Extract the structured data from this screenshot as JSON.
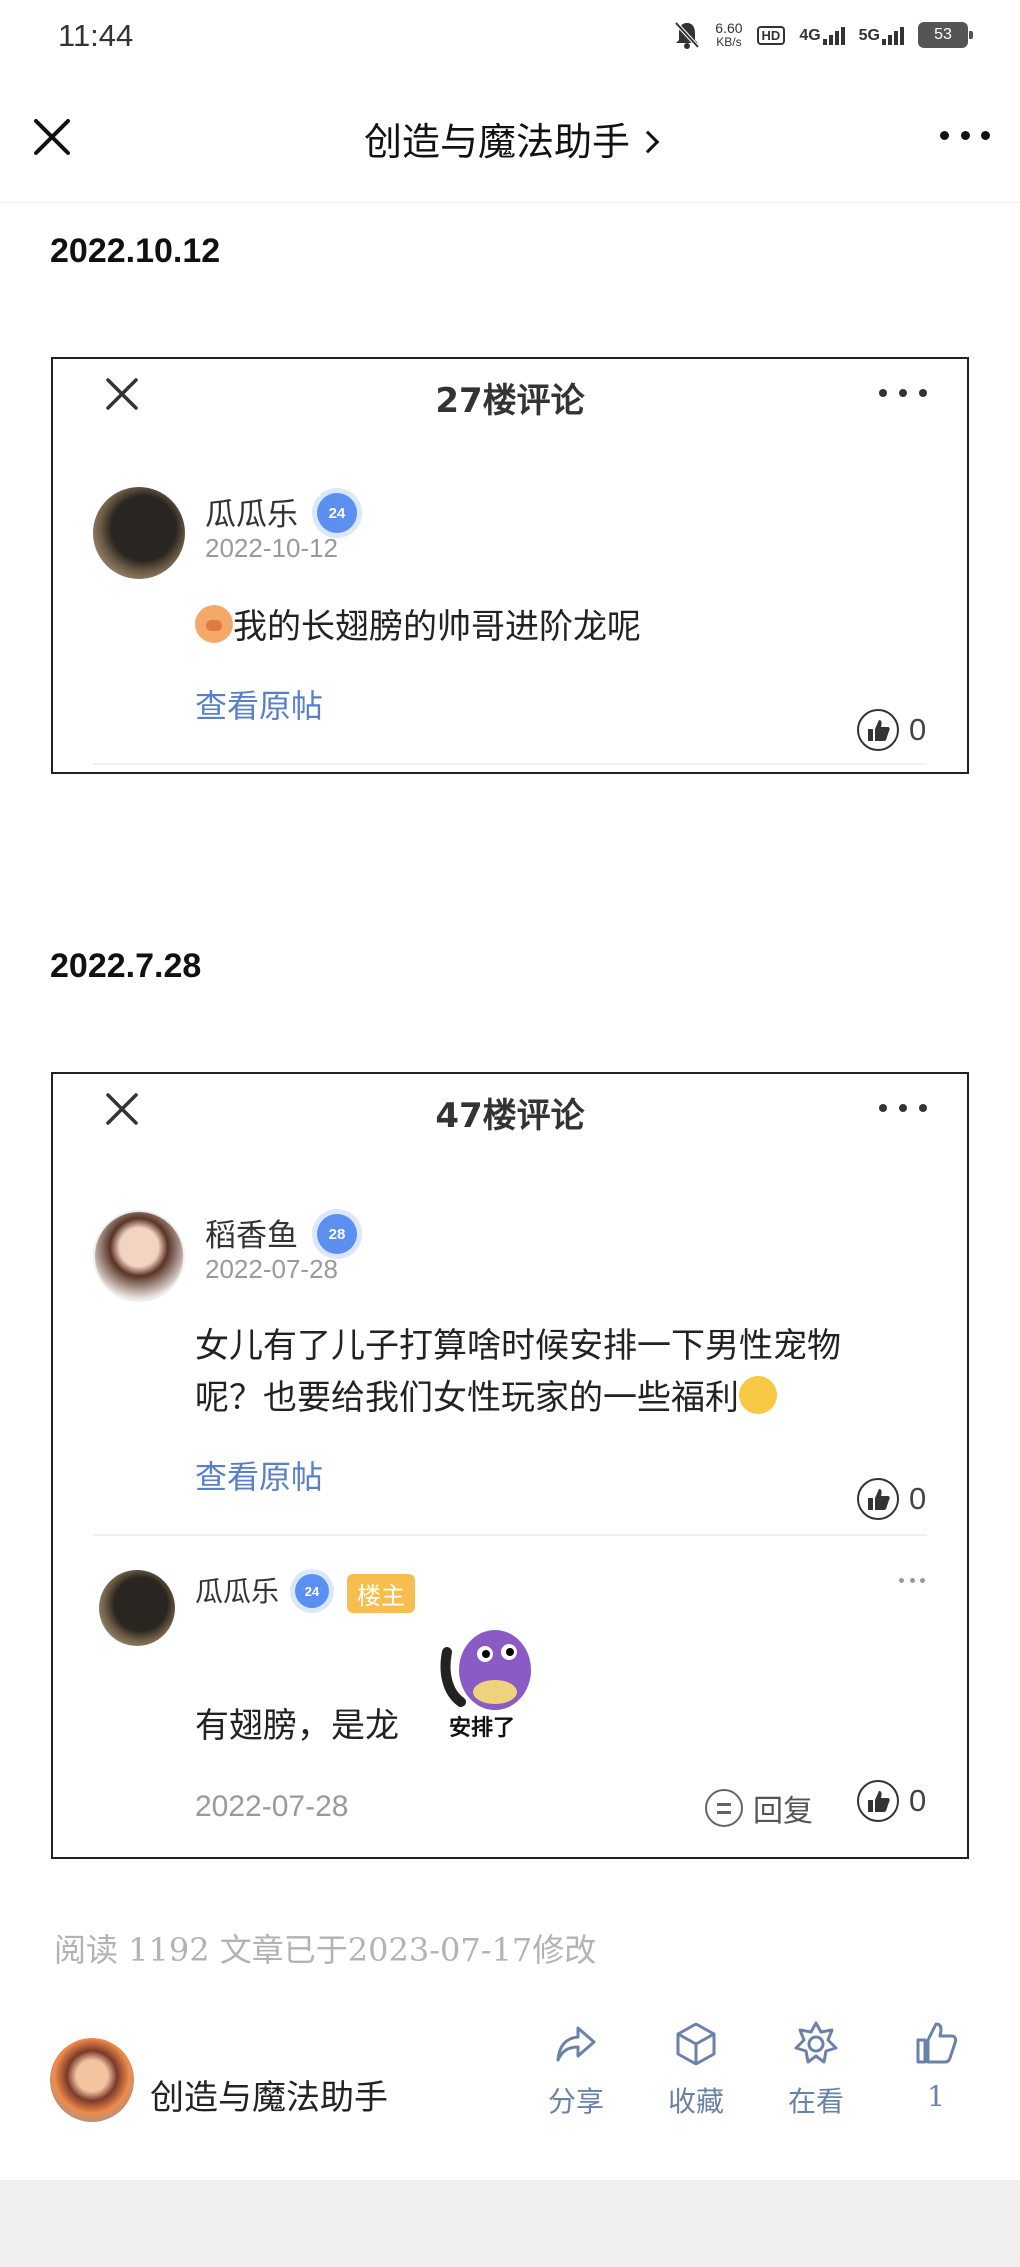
{
  "status_bar": {
    "time": "11:44",
    "net_speed_value": "6.60",
    "net_speed_unit": "KB/s",
    "hd_label": "HD",
    "sig1": "4G",
    "sig2": "5G",
    "battery": "53"
  },
  "nav": {
    "title": "创造与魔法助手",
    "close_icon": "close-icon",
    "more_icon": "more-icon"
  },
  "section1": {
    "date": "2022.10.12",
    "card": {
      "title": "27楼评论",
      "user": "瓜瓜乐",
      "level": "24",
      "date": "2022-10-12",
      "text": "我的长翅膀的帅哥进阶龙呢",
      "view_original": "查看原帖",
      "likes": "0"
    }
  },
  "section2": {
    "date": "2022.7.28",
    "card": {
      "title": "47楼评论",
      "user": "稻香鱼",
      "level": "28",
      "date": "2022-07-28",
      "text_line1": "女儿有了儿子打算啥时候安排一下男性宠物",
      "text_line2": "呢？也要给我们女性玩家的一些福利",
      "view_original": "查看原帖",
      "likes": "0",
      "reply": {
        "user": "瓜瓜乐",
        "level": "24",
        "badge": "楼主",
        "text": "有翅膀，是龙",
        "sticker_text": "安排了",
        "date": "2022-07-28",
        "reply_label": "回复",
        "likes": "0"
      }
    }
  },
  "footer": {
    "read_info": "阅读 1192   文章已于2023-07-17修改",
    "author": "创造与魔法助手",
    "actions": [
      {
        "label": "分享",
        "icon": "share-icon"
      },
      {
        "label": "收藏",
        "icon": "favorite-box-icon"
      },
      {
        "label": "在看",
        "icon": "watching-icon"
      },
      {
        "label": "1",
        "icon": "thumbs-up-icon"
      }
    ]
  }
}
